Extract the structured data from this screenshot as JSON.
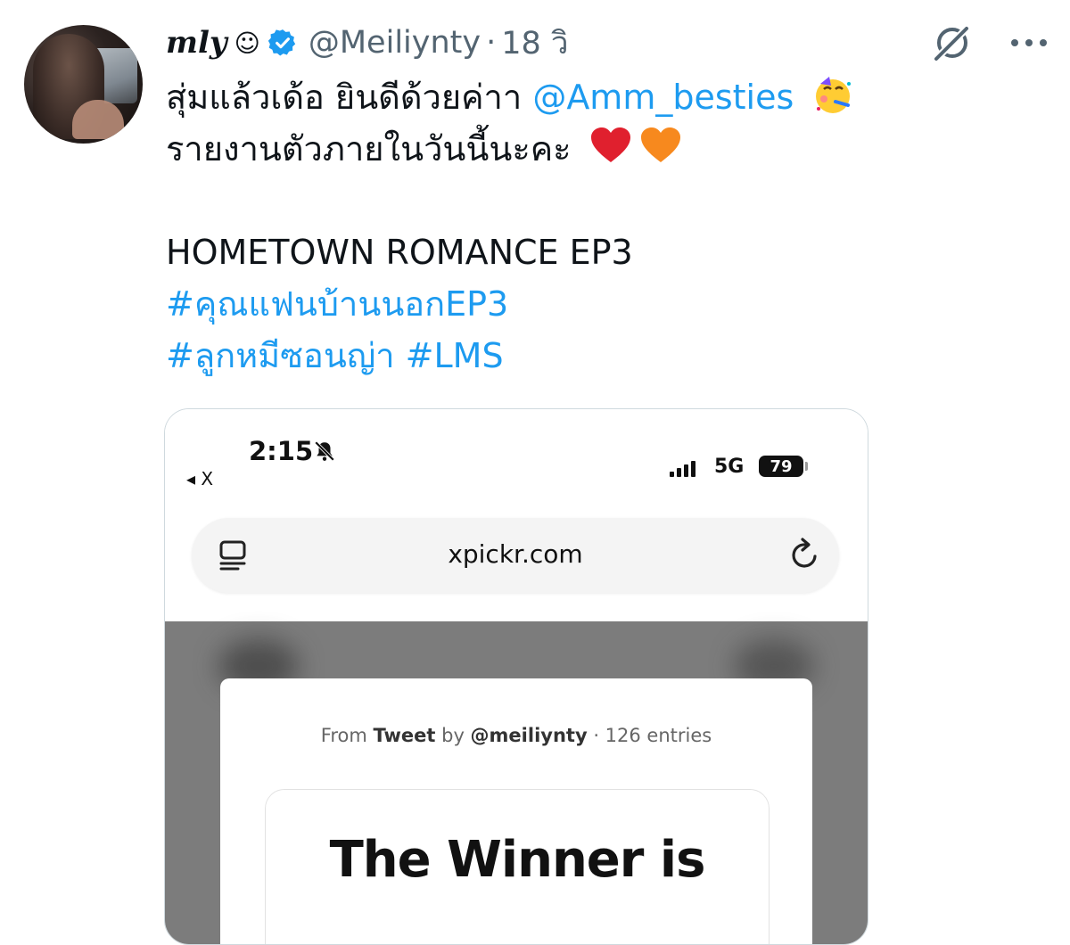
{
  "tweet": {
    "display_name": "mly",
    "name_emoji": "☺",
    "handle": "@Meiliynty",
    "separator": "·",
    "time": "18 วิ",
    "text_line1": "สุ่มแล้วเด้อ ยินดีด้วยค่าา ",
    "mention": "@Amm_besties",
    "text_line2": "รายงานตัวภายในวันนี้นะคะ",
    "text_line3": "HOMETOWN ROMANCE EP3",
    "hashtag1": "#คุณแฟนบ้านนอกEP3",
    "hashtag2": "#ลูกหมีซอนญ่า",
    "hashtag3": "#LMS",
    "emojis": [
      "partying-face",
      "red-heart",
      "orange-heart"
    ]
  },
  "screenshot": {
    "status_time": "2:15",
    "back_label": "◂ X",
    "network": "5G",
    "battery": "79",
    "url": "xpickr.com",
    "meta_from": "From ",
    "meta_source": "Tweet",
    "meta_by": " by ",
    "meta_user": "@meiliynty",
    "meta_entries": " · 126 entries",
    "winner_title": "The Winner is"
  },
  "colors": {
    "link": "#1d9bf0",
    "muted": "#536471",
    "verified": "#1d9bf0"
  }
}
